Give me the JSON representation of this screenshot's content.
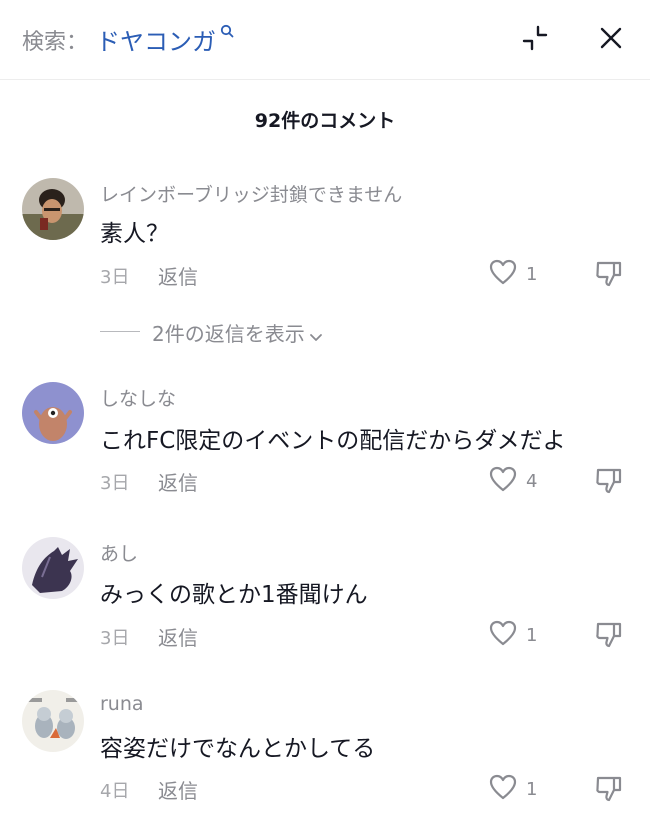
{
  "search": {
    "prefix": "検索：",
    "query": "ドヤコンガ"
  },
  "comments_header": {
    "count_label": "92件のコメント"
  },
  "comments": [
    {
      "username": "レインボーブリッジ封鎖できません",
      "text": "素人？",
      "date": "3日",
      "reply_label": "返信",
      "likes": "1",
      "view_replies_label": "2件の返信を表示"
    },
    {
      "username": "しなしな",
      "text": "これFC限定のイベントの配信だからダメだよ",
      "date": "3日",
      "reply_label": "返信",
      "likes": "4"
    },
    {
      "username": "あし",
      "text": "みっくの歌とか1番聞けん",
      "date": "3日",
      "reply_label": "返信",
      "likes": "1"
    },
    {
      "username": "runa",
      "text": "容姿だけでなんとかしてる",
      "date": "4日",
      "reply_label": "返信",
      "likes": "1"
    }
  ],
  "icons": {
    "search": "search-icon",
    "minimize": "minimize-icon",
    "close": "close-icon",
    "like": "heart-icon",
    "dislike": "thumbs-down-icon",
    "chevron": "chevron-down-icon"
  },
  "colors": {
    "query": "#2b5db5",
    "secondary_text": "#8a8b91",
    "primary_text": "#161823"
  }
}
